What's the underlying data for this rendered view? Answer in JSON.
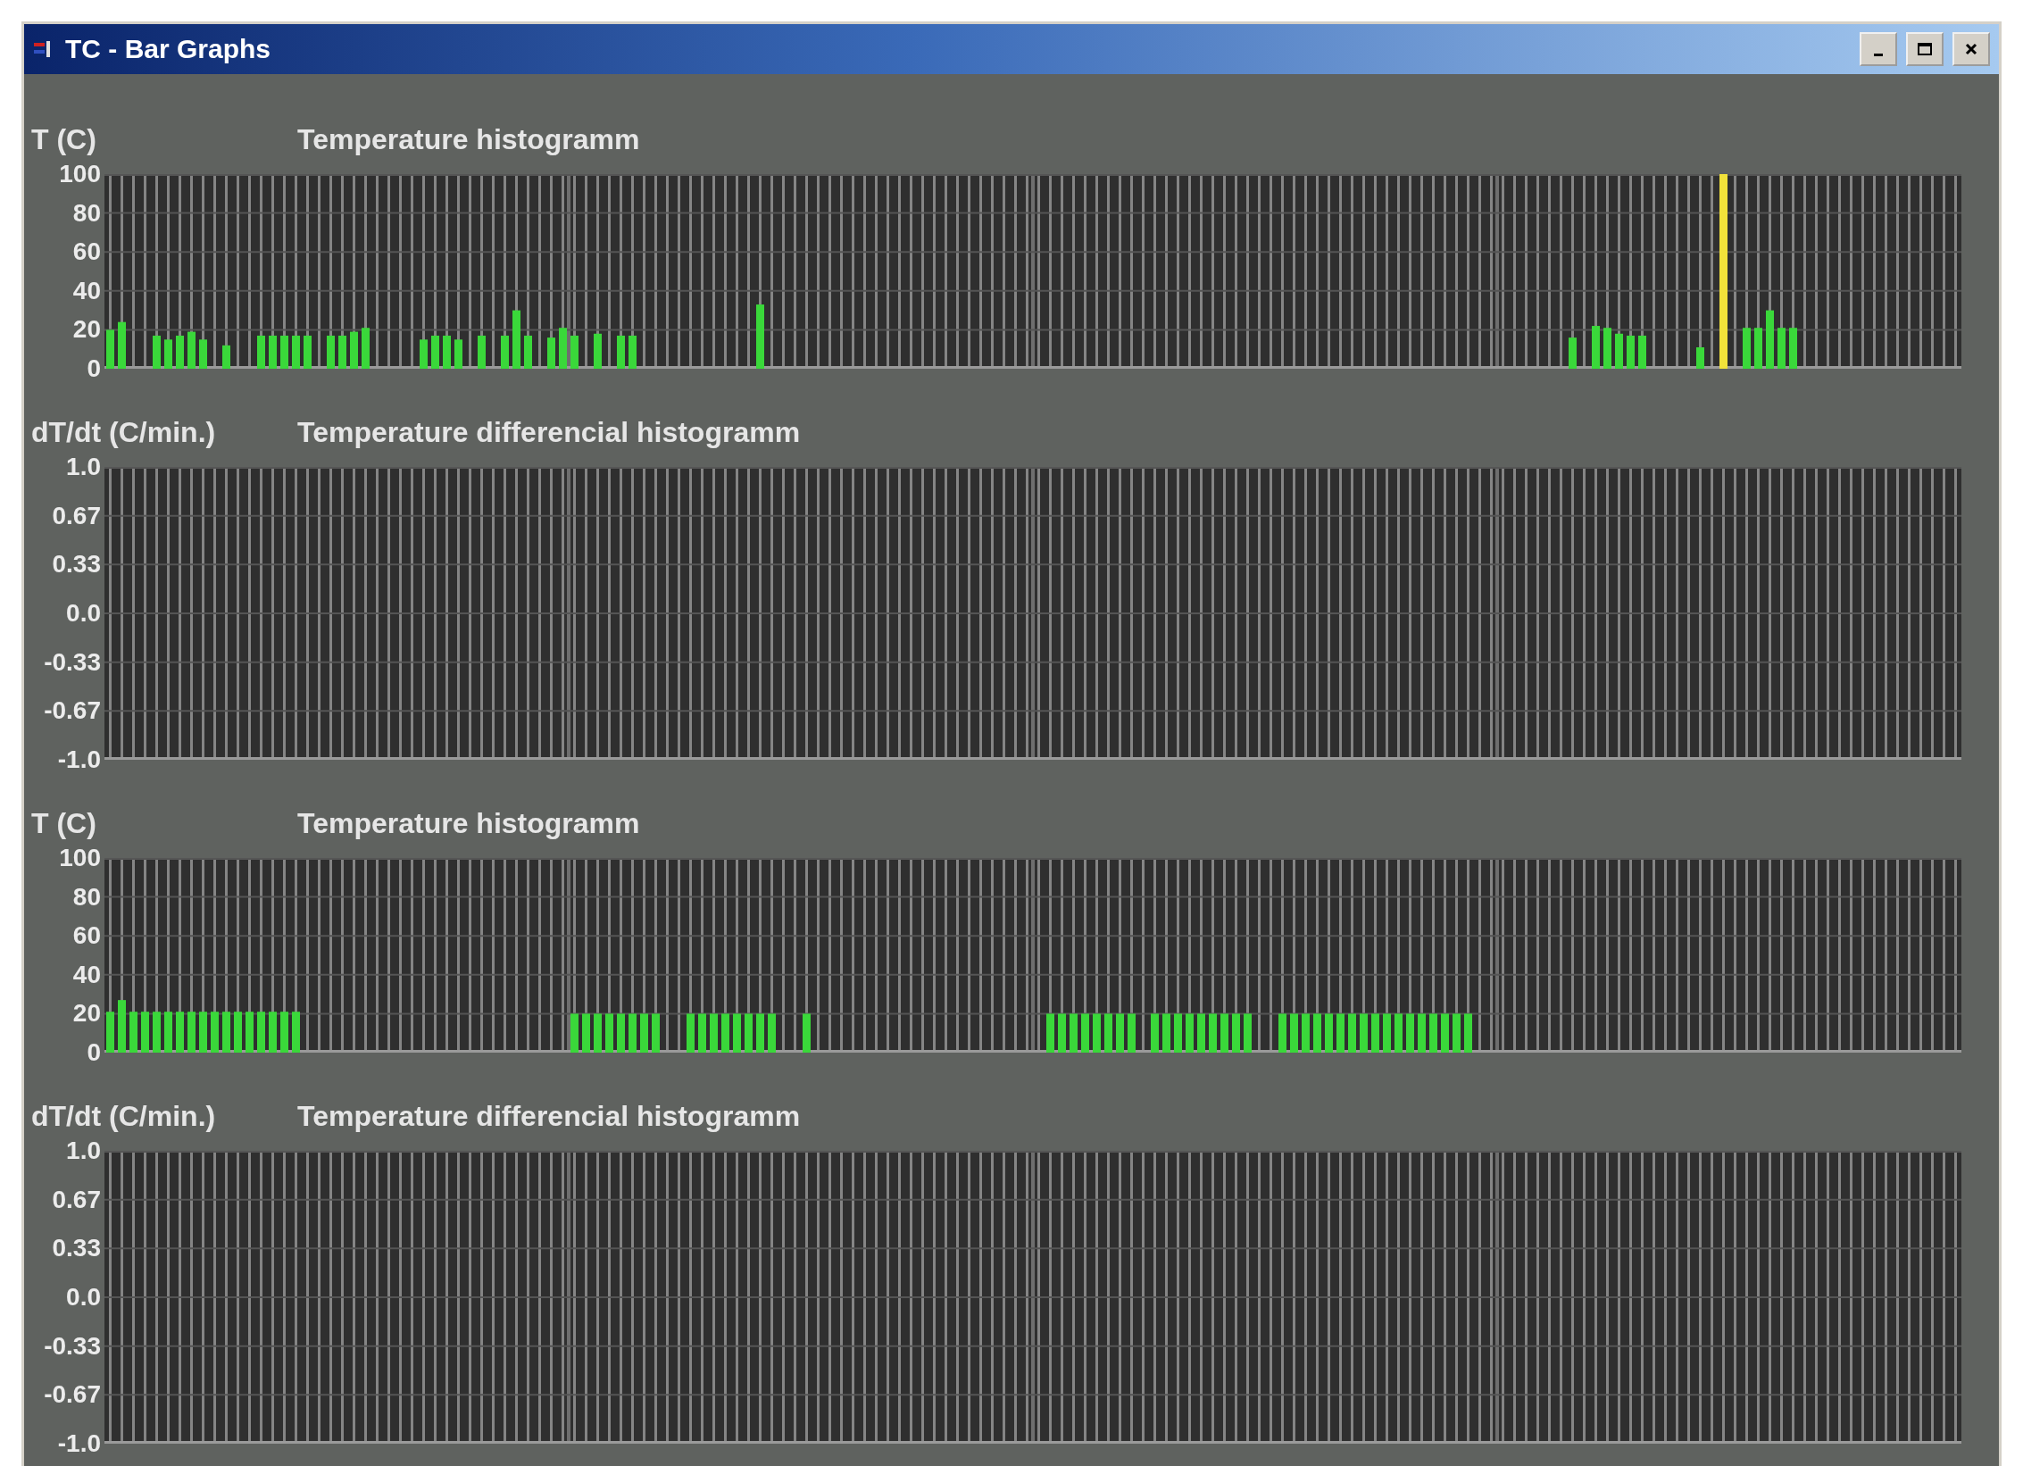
{
  "window": {
    "title": "TC - Bar Graphs"
  },
  "charts": [
    {
      "chart_data": {
        "type": "bar",
        "title": "Temperature histogramm",
        "ylabel": "T (C)",
        "ylim": [
          0,
          100
        ],
        "grid": true,
        "yticks": [
          {
            "value": 0,
            "label": "0"
          },
          {
            "value": 20,
            "label": "20"
          },
          {
            "value": 40,
            "label": "40"
          },
          {
            "value": 60,
            "label": "60"
          },
          {
            "value": 80,
            "label": "80"
          },
          {
            "value": 100,
            "label": "100"
          }
        ],
        "categories": [
          null,
          null,
          null,
          null,
          null,
          null,
          null,
          null,
          null,
          null,
          null,
          null,
          null,
          null,
          null,
          null,
          null,
          null,
          null,
          null,
          null,
          null,
          null,
          null,
          null,
          null,
          null,
          null,
          null,
          null,
          null,
          null,
          null,
          null,
          null,
          null,
          null,
          null,
          null,
          null,
          null,
          null,
          null,
          null,
          null,
          null,
          null,
          null,
          null,
          null,
          null,
          null,
          null,
          null,
          null,
          null,
          null,
          null,
          null,
          null,
          null,
          null,
          null,
          null,
          null,
          null,
          null,
          null,
          null,
          null,
          null,
          null,
          null,
          null,
          null,
          null,
          null,
          null,
          null,
          null,
          null,
          null,
          null,
          null,
          null,
          null,
          null,
          null,
          null,
          null,
          null,
          null,
          null,
          null,
          null,
          null,
          null,
          null,
          null,
          null,
          null,
          null,
          null,
          null,
          null,
          null,
          null,
          null,
          null,
          null,
          null,
          null,
          null,
          null,
          null,
          null,
          null,
          null,
          null,
          null,
          null,
          null,
          null,
          null,
          null,
          null,
          null,
          null,
          null,
          null,
          null,
          null,
          null,
          null,
          null,
          null,
          null,
          null,
          null,
          null,
          null,
          null,
          null,
          null,
          null,
          null,
          null,
          null,
          null,
          null,
          null,
          null,
          null,
          null,
          null,
          null,
          null,
          null,
          null,
          null
        ],
        "series": [
          {
            "color": "#3ad83a",
            "values": [
              20,
              24,
              null,
              null,
              17,
              15,
              17,
              19,
              15,
              null,
              12,
              null,
              null,
              17,
              17,
              17,
              17,
              17,
              null,
              17,
              17,
              19,
              21,
              null,
              null,
              null,
              null,
              15,
              17,
              17,
              15,
              null,
              17,
              null,
              17,
              30,
              17,
              null,
              16,
              21,
              17,
              null,
              18,
              null,
              17,
              17,
              null,
              null,
              null,
              null,
              null,
              null,
              null,
              null,
              null,
              null,
              33,
              null,
              null,
              null,
              null,
              null,
              null,
              null,
              null,
              null,
              null,
              null,
              null,
              null,
              null,
              null,
              null,
              null,
              null,
              null,
              null,
              null,
              null,
              null,
              null,
              null,
              null,
              null,
              null,
              null,
              null,
              null,
              null,
              null,
              null,
              null,
              null,
              null,
              null,
              null,
              null,
              null,
              null,
              null,
              null,
              null,
              null,
              null,
              null,
              null,
              null,
              null,
              null,
              null,
              null,
              null,
              null,
              null,
              null,
              null,
              null,
              null,
              null,
              null,
              null,
              null,
              null,
              null,
              null,
              null,
              16,
              null,
              22,
              21,
              18,
              17,
              17,
              null,
              null,
              null,
              null,
              11,
              null,
              null,
              null,
              21,
              21,
              30,
              21,
              21,
              null,
              null,
              null,
              null,
              null,
              null,
              null,
              null,
              null,
              null,
              null,
              null,
              null,
              null
            ]
          },
          {
            "color": "#f2e23a",
            "values": [
              null,
              null,
              null,
              null,
              null,
              null,
              null,
              null,
              null,
              null,
              null,
              null,
              null,
              null,
              null,
              null,
              null,
              null,
              null,
              null,
              null,
              null,
              null,
              null,
              null,
              null,
              null,
              null,
              null,
              null,
              null,
              null,
              null,
              null,
              null,
              null,
              null,
              null,
              null,
              null,
              null,
              null,
              null,
              null,
              null,
              null,
              null,
              null,
              null,
              null,
              null,
              null,
              null,
              null,
              null,
              null,
              null,
              null,
              null,
              null,
              null,
              null,
              null,
              null,
              null,
              null,
              null,
              null,
              null,
              null,
              null,
              null,
              null,
              null,
              null,
              null,
              null,
              null,
              null,
              null,
              null,
              null,
              null,
              null,
              null,
              null,
              null,
              null,
              null,
              null,
              null,
              null,
              null,
              null,
              null,
              null,
              null,
              null,
              null,
              null,
              null,
              null,
              null,
              null,
              null,
              null,
              null,
              null,
              null,
              null,
              null,
              null,
              null,
              null,
              null,
              null,
              null,
              null,
              null,
              null,
              null,
              null,
              null,
              null,
              null,
              null,
              null,
              null,
              null,
              null,
              null,
              null,
              null,
              null,
              null,
              null,
              null,
              null,
              null,
              100,
              null,
              null,
              null,
              null,
              null,
              null,
              null,
              null,
              null,
              null,
              null,
              null,
              null,
              null,
              null,
              null,
              null,
              null,
              null,
              null
            ]
          }
        ]
      }
    },
    {
      "title": "Temperature differencial histogramm",
      "ylabel": "dT/dt (C/min.)",
      "tick_labels": [
        "1.0",
        "0.67",
        "0.33",
        "0.0",
        "-0.33",
        "-0.67",
        "-1.0"
      ]
    },
    {
      "chart_data": {
        "type": "bar",
        "title": "Temperature histogramm",
        "ylabel": "T (C)",
        "ylim": [
          0,
          100
        ],
        "grid": true,
        "yticks": [
          {
            "value": 0,
            "label": "0"
          },
          {
            "value": 20,
            "label": "20"
          },
          {
            "value": 40,
            "label": "40"
          },
          {
            "value": 60,
            "label": "60"
          },
          {
            "value": 80,
            "label": "80"
          },
          {
            "value": 100,
            "label": "100"
          }
        ],
        "categories": [
          null,
          null,
          null,
          null,
          null,
          null,
          null,
          null,
          null,
          null,
          null,
          null,
          null,
          null,
          null,
          null,
          null,
          null,
          null,
          null,
          null,
          null,
          null,
          null,
          null,
          null,
          null,
          null,
          null,
          null,
          null,
          null,
          null,
          null,
          null,
          null,
          null,
          null,
          null,
          null,
          null,
          null,
          null,
          null,
          null,
          null,
          null,
          null,
          null,
          null,
          null,
          null,
          null,
          null,
          null,
          null,
          null,
          null,
          null,
          null,
          null,
          null,
          null,
          null,
          null,
          null,
          null,
          null,
          null,
          null,
          null,
          null,
          null,
          null,
          null,
          null,
          null,
          null,
          null,
          null,
          null,
          null,
          null,
          null,
          null,
          null,
          null,
          null,
          null,
          null,
          null,
          null,
          null,
          null,
          null,
          null,
          null,
          null,
          null,
          null,
          null,
          null,
          null,
          null,
          null,
          null,
          null,
          null,
          null,
          null,
          null,
          null,
          null,
          null,
          null,
          null,
          null,
          null,
          null,
          null,
          null,
          null,
          null,
          null,
          null,
          null,
          null,
          null,
          null,
          null,
          null,
          null,
          null,
          null,
          null,
          null,
          null,
          null,
          null,
          null,
          null,
          null,
          null,
          null,
          null,
          null,
          null,
          null,
          null,
          null,
          null,
          null,
          null,
          null,
          null,
          null,
          null,
          null,
          null,
          null
        ],
        "series": [
          {
            "color": "#3ad83a",
            "values": [
              21,
              27,
              21,
              21,
              21,
              21,
              21,
              21,
              21,
              21,
              21,
              21,
              21,
              21,
              21,
              21,
              21,
              null,
              null,
              null,
              null,
              null,
              null,
              null,
              null,
              null,
              null,
              null,
              null,
              null,
              null,
              null,
              null,
              null,
              null,
              null,
              null,
              null,
              null,
              null,
              20,
              20,
              20,
              20,
              20,
              20,
              20,
              20,
              null,
              null,
              20,
              20,
              20,
              20,
              20,
              20,
              20,
              20,
              null,
              null,
              20,
              null,
              null,
              null,
              null,
              null,
              null,
              null,
              null,
              null,
              null,
              null,
              null,
              null,
              null,
              null,
              null,
              null,
              null,
              null,
              null,
              20,
              20,
              20,
              20,
              20,
              20,
              20,
              20,
              null,
              20,
              20,
              20,
              20,
              20,
              20,
              20,
              20,
              20,
              null,
              null,
              20,
              20,
              20,
              20,
              20,
              20,
              20,
              20,
              20,
              20,
              20,
              20,
              20,
              20,
              20,
              20,
              20,
              null,
              null,
              null,
              null,
              null,
              null,
              null,
              null,
              null,
              null,
              null,
              null,
              null,
              null,
              null,
              null,
              null,
              null,
              null,
              null,
              null,
              null,
              null,
              null,
              null,
              null,
              null,
              null,
              null,
              null,
              null,
              null,
              null,
              null,
              null,
              null,
              null,
              null,
              null,
              null,
              null,
              null
            ]
          }
        ]
      }
    },
    {
      "title": "Temperature differencial histogramm",
      "ylabel": "dT/dt (C/min.)",
      "tick_labels": [
        "1.0",
        "0.67",
        "0.33",
        "0.0",
        "-0.33",
        "-0.67",
        "-1.0"
      ]
    }
  ]
}
